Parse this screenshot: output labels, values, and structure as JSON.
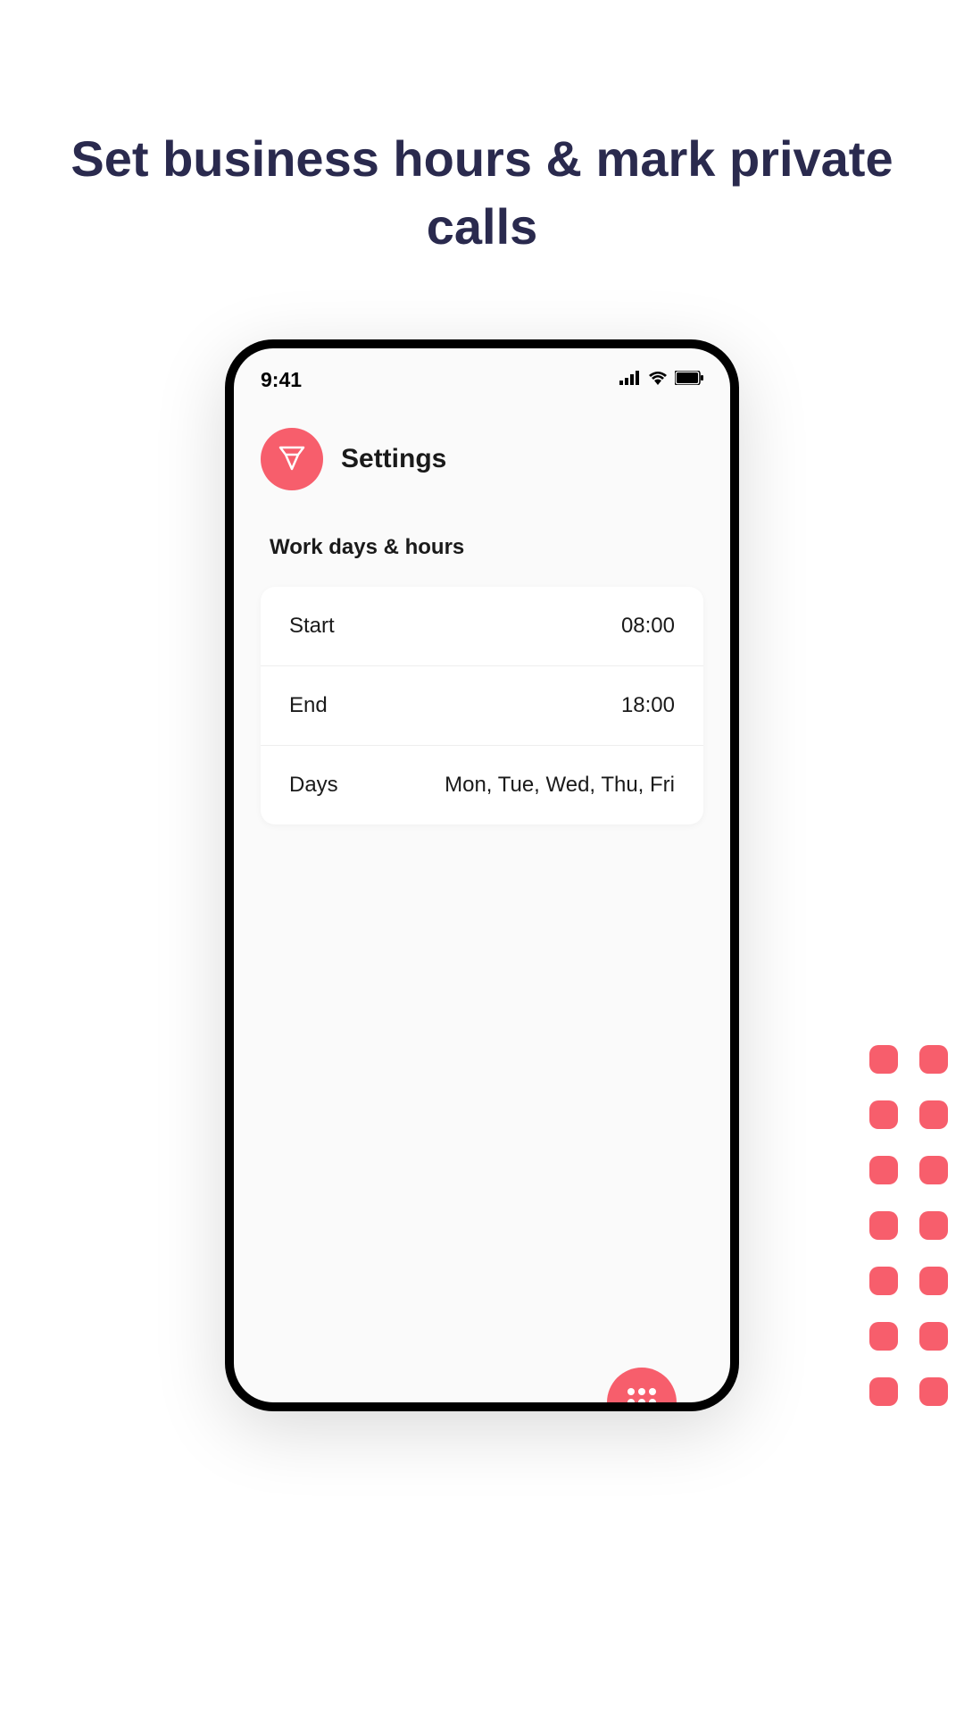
{
  "headline": "Set business hours & mark private calls",
  "status_bar": {
    "time": "9:41"
  },
  "header": {
    "title": "Settings"
  },
  "section": {
    "title": "Work days & hours"
  },
  "settings": {
    "start": {
      "label": "Start",
      "value": "08:00"
    },
    "end": {
      "label": "End",
      "value": "18:00"
    },
    "days": {
      "label": "Days",
      "value": "Mon, Tue, Wed, Thu, Fri"
    }
  },
  "colors": {
    "accent": "#f75e6c",
    "heading": "#2a2a4e"
  }
}
